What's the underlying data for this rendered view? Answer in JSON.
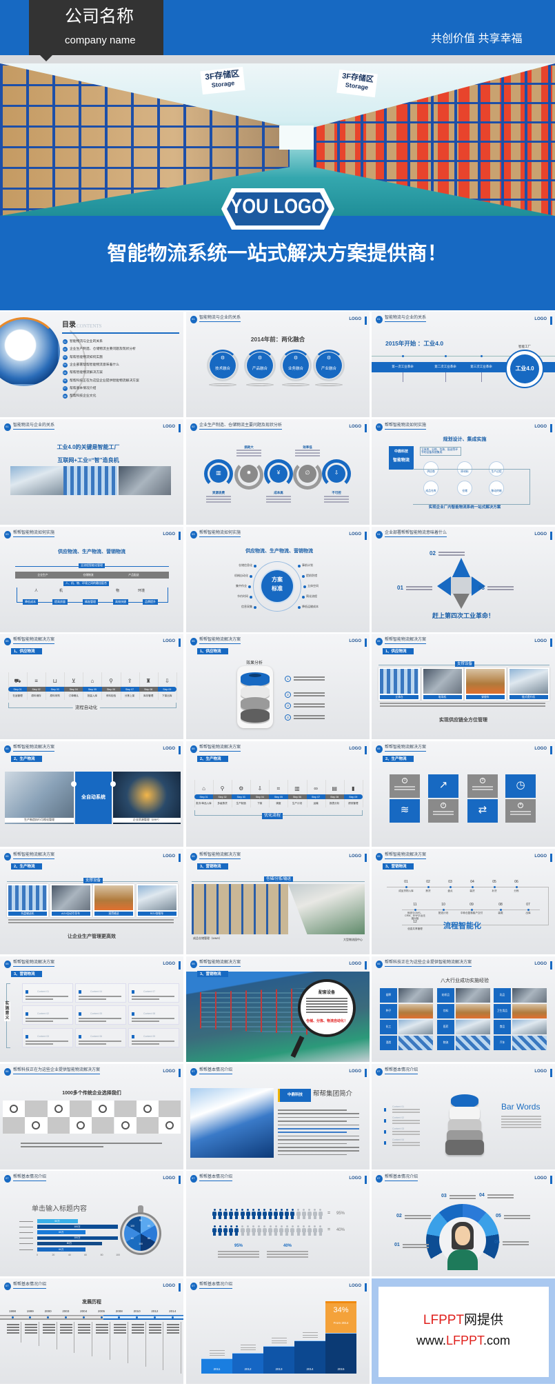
{
  "banner": {
    "company_name": "公司名称",
    "company_name_en": "company name",
    "slogan": "共创价值 共享幸福",
    "sign_left": {
      "cn": "3F存储区",
      "en": "Storage"
    },
    "sign_right": {
      "cn": "3F存储区",
      "en": "Storage"
    },
    "logo_text": "YOU LOGO",
    "headline": "智能物流系统一站式解决方案提供商！",
    "colors": {
      "brand_blue": "#1769c2",
      "dark_box": "#333333",
      "strip": "#d9dadc"
    }
  },
  "logo_label": "LOGO",
  "slides": [
    {
      "kind": "toc",
      "heading": "目录",
      "heading_en": "CONTENTS",
      "items": [
        {
          "n": "01",
          "label": "智能物流与企业的关系"
        },
        {
          "n": "02",
          "label": "企业生产制造、仓储物流主要问题及现状分析"
        },
        {
          "n": "03",
          "label": "帮帮智能物流如何实施"
        },
        {
          "n": "04",
          "label": "企业部署帮帮智能物流意味着什么"
        },
        {
          "n": "05",
          "label": "帮帮智能物流解决方案"
        },
        {
          "n": "06",
          "label": "帮帮科技正在为这些企业提供智能物流解决方案"
        },
        {
          "n": "07",
          "label": "帮帮基本情况介绍"
        },
        {
          "n": "08",
          "label": "帮帮科技企业文化"
        }
      ]
    },
    {
      "kind": "circles4",
      "num": "01",
      "title": "智能物流与企业的关系",
      "heading": "2014年前：两化融合",
      "items": [
        "技术融合",
        "产品融合",
        "业务融合",
        "产业融合"
      ]
    },
    {
      "kind": "industry4",
      "num": "01",
      "title": "智能物流与企业的关系",
      "heading": "2015年开始 ：工业4.0",
      "items": [
        "第一次工业革命",
        "第二次工业革命",
        "第三次工业革命"
      ],
      "circle_small": "智能工厂",
      "circle_big": "工业4.0"
    },
    {
      "kind": "photos3",
      "num": "01",
      "title": "智能物流与企业的关系",
      "heading": "工业4.0的关键是智能工厂",
      "heading2": "互联网+工业=“智”造良机"
    },
    {
      "kind": "wave",
      "num": "02",
      "title": "企业生产制造、仓储物流主要问题及现状分析",
      "items": [
        "资源浪费",
        "损耗大",
        "成本高",
        "效率低",
        "不可控"
      ]
    },
    {
      "kind": "plan",
      "num": "03",
      "title": "帮帮智能物流如何实施",
      "heading": "规划设计、集成实施",
      "box": [
        "中鼎科技",
        "智能物流"
      ],
      "tag": "立体库、分拣、包装、配送等环节的设备系统集成",
      "nodes": [
        "供应商",
        "原材料",
        "生产过程",
        "成品仓库",
        "仓储",
        "移动终端"
      ],
      "footer": "实现企业厂内智能物流系统一站式解决方案"
    },
    {
      "kind": "flow",
      "num": "03",
      "title": "帮帮智能物流如何实施",
      "heading": "供应物流、生产物流、营销物流",
      "top_tag": "全流程智能化管理",
      "mid_tag": "人、机、物、环境之间的最佳配合",
      "bar_items": [
        "企业生产",
        "仓储物流",
        "产品配送"
      ],
      "elements": [
        "人",
        "机",
        "物",
        "环境"
      ],
      "boxes": [
        "降低成本",
        "提高质量",
        "精准管理",
        "高效快捷",
        "品牌提升"
      ]
    },
    {
      "kind": "radial",
      "num": "03",
      "title": "帮帮智能物流如何实施",
      "heading": "供应物流、生产物流、营销物流",
      "center": [
        "方案",
        "标准"
      ],
      "left": [
        "仓储信息化",
        "机械自动化",
        "集中作业",
        "节约时间",
        "信息采集"
      ],
      "right": [
        "事前计划",
        "提前防错",
        "立体空间",
        "简化流程",
        "降低运输成本"
      ]
    },
    {
      "kind": "pyramid",
      "num": "04",
      "title": "企业部署帮帮智能物流意味着什么",
      "labels": [
        "01",
        "02",
        "03"
      ],
      "footer": "赶上第四次工业革命！"
    },
    {
      "kind": "steps",
      "num": "05",
      "title": "帮帮智能物流解决方案",
      "sub": "1、供应物流",
      "steps": [
        "Step 01",
        "Step 02",
        "Step 03",
        "Step 04",
        "Step 05",
        "Step 06",
        "Step 07",
        "Step 08",
        "Step 09"
      ],
      "labels": [
        "在途管理",
        "原料储存",
        "原料采购",
        "订单确认",
        "批量入库",
        "来料检验",
        "分拣上架",
        "库存管理",
        "下架出库"
      ],
      "icons": [
        "truck-icon",
        "database-icon",
        "basket-icon",
        "cart-icon",
        "house-icon",
        "search-icon",
        "upload-icon",
        "worker-icon",
        "download-icon"
      ],
      "footer": "流程自动化"
    },
    {
      "kind": "cylinder",
      "num": "05",
      "title": "帮帮智能物流解决方案",
      "sub": "1、供应物流",
      "heading": "效果分析",
      "items": [
        "1",
        "2",
        "3",
        "4"
      ]
    },
    {
      "kind": "equip",
      "num": "05",
      "title": "帮帮智能物流解决方案",
      "sub": "1、供应物流",
      "heading": "支撑设备",
      "items": [
        "立体仓",
        "堆垛机",
        "穿梭车",
        "链式提升机"
      ],
      "footer": "实现供应链全方位管理"
    },
    {
      "kind": "auto",
      "num": "05",
      "title": "帮帮智能物流解决方案",
      "sub": "2、生产物流",
      "center": "全自动系统",
      "captions": [
        "生产制造执行可视化管理",
        "企业资源管理（ERP）"
      ]
    },
    {
      "kind": "steps",
      "num": "05",
      "title": "帮帮智能物流解决方案",
      "sub": "2、生产物流",
      "steps": [
        "Step 01",
        "Step 02",
        "Step 03",
        "Step 04",
        "Step 05",
        "Step 06",
        "Step 07",
        "Step 08",
        "Step 09"
      ],
      "labels": [
        "批次/单品入库",
        "多级拣货",
        "生产制造",
        "下架",
        "调度",
        "生产计划",
        "运输",
        "报表分析",
        "绩效管理"
      ],
      "icons": [
        "house-icon",
        "search-icon",
        "gears-icon",
        "download-icon",
        "crop-icon",
        "book-icon",
        "tape-icon",
        "document-icon",
        "chart-icon"
      ],
      "footer": "优化流程"
    },
    {
      "kind": "tiles",
      "num": "05",
      "title": "帮帮智能物流解决方案",
      "sub": "2、生产物流",
      "tiles": [
        "1",
        "",
        "3",
        "",
        "",
        "2",
        "",
        "4"
      ]
    },
    {
      "kind": "equip",
      "num": "05",
      "title": "帮帮智能物流解决方案",
      "sub": "2、生产物流",
      "heading": "支撑设备",
      "items": [
        "托盘输送机",
        "AGV自动引导车",
        "滚筒输送",
        "RGV穿梭车"
      ],
      "footer": "让企业生产管理更高效"
    },
    {
      "kind": "wide",
      "num": "05",
      "title": "帮帮智能物流解决方案",
      "sub": "3、营销物流",
      "heading": "仓储/分拣/输送",
      "captions": [
        "成品仓储管理（WMS）",
        "大型物流园中心"
      ]
    },
    {
      "kind": "timeline",
      "num": "05",
      "title": "帮帮智能物流解决方案",
      "sub": "3、营销物流",
      "top": [
        {
          "n": "01",
          "l": "成品货物入库"
        },
        {
          "n": "02",
          "l": "拣货"
        },
        {
          "n": "03",
          "l": "盘点"
        },
        {
          "n": "04",
          "l": "装货"
        },
        {
          "n": "05",
          "l": "补货"
        },
        {
          "n": "06",
          "l": "分拣"
        }
      ],
      "bottom": [
        {
          "n": "11",
          "l": "系统与OMS、CRM、ERP平台无缝对接"
        },
        {
          "n": "10",
          "l": "配送计划"
        },
        {
          "n": "09",
          "l": "中转仓复核客户交付"
        },
        {
          "n": "08",
          "l": "装载"
        },
        {
          "n": "07",
          "l": "出库"
        }
      ],
      "last": {
        "n": "12",
        "l": "信息共享管理"
      },
      "footer": "流程智能化"
    },
    {
      "kind": "grid9",
      "num": "05",
      "title": "帮帮智能物流解决方案",
      "sub": "3、营销物流",
      "side": "实施意义",
      "cells": [
        "Content 01",
        "Content 04",
        "Content 07",
        "Content 02",
        "Content 05",
        "Content 08",
        "Content 03",
        "Content 06",
        "Content 09"
      ]
    },
    {
      "kind": "magnifier",
      "num": "05",
      "title": "帮帮智能物流解决方案",
      "sub": "3、营销物流",
      "heading": "配套设备",
      "slogan": "仓储、分拣、物流自动化！"
    },
    {
      "kind": "industries",
      "num": "06",
      "title": "帮帮科技正在为这些企业提供智能物流解决方案",
      "heading": "八大行业成功实施经验",
      "items": [
        "烟草",
        "种子",
        "化工",
        "酒类",
        "纺织品",
        "饮料",
        "医药",
        "物流",
        "乳品",
        "卫生用品",
        "食品",
        "汽车"
      ]
    },
    {
      "kind": "logos",
      "num": "06",
      "title": "帮帮科技正在为这些企业提供智能物流解决方案",
      "heading": "1000多个传统企业选择我们"
    },
    {
      "kind": "intro",
      "num": "07",
      "title": "帮帮基本情况介绍",
      "box": "中鼎科技",
      "heading": "帮帮集团简介"
    },
    {
      "kind": "barwords",
      "num": "07",
      "title": "帮帮基本情况介绍",
      "heading": "Bar Words",
      "items": [
        "Content 01",
        "Content 02",
        "Content 03",
        "Content 04"
      ]
    },
    {
      "kind": "hbar",
      "num": "07",
      "title": "帮帮基本情况介绍",
      "heading": "单击输入标题内容",
      "bars": [
        {
          "v": 50,
          "l": "50万"
        },
        {
          "v": 100,
          "l": "100万"
        },
        {
          "v": 60,
          "l": "60万"
        },
        {
          "v": 100,
          "l": "100万"
        },
        {
          "v": 80,
          "l": "80万"
        },
        {
          "v": 60,
          "l": "60万"
        }
      ],
      "ticks": [
        "0",
        "20",
        "40",
        "60",
        "80",
        "100"
      ],
      "dial": [
        "50",
        "60",
        "80",
        "100",
        "60",
        "100"
      ]
    },
    {
      "kind": "people",
      "num": "07",
      "title": "帮帮基本情况介绍",
      "rows": [
        {
          "pct": 95,
          "label": "95%",
          "filled": 15
        },
        {
          "pct": 40,
          "label": "40%",
          "filled": 5
        }
      ]
    },
    {
      "kind": "woman",
      "num": "07",
      "title": "帮帮基本情况介绍",
      "labels": [
        "01",
        "02",
        "03",
        "04",
        "05",
        "06"
      ]
    },
    {
      "kind": "history",
      "num": "07",
      "title": "帮帮基本情况介绍",
      "heading": "发展历程",
      "years": [
        "1998",
        "1999",
        "2000",
        "2003",
        "2004",
        "2005",
        "2008",
        "2010",
        "2012",
        "2014"
      ]
    },
    {
      "kind": "stairs",
      "num": "07",
      "title": "帮帮基本情况介绍",
      "years": [
        "2011",
        "2012",
        "2013",
        "2014",
        "2015"
      ],
      "highlight": "34%",
      "highlight_sub": "From 2014"
    },
    {
      "kind": "ad",
      "line1_red": "LFPPT",
      "line1_black": "网提供",
      "line2_a": "www.",
      "line2_red": "LFPPT",
      "line2_b": ".com"
    }
  ]
}
